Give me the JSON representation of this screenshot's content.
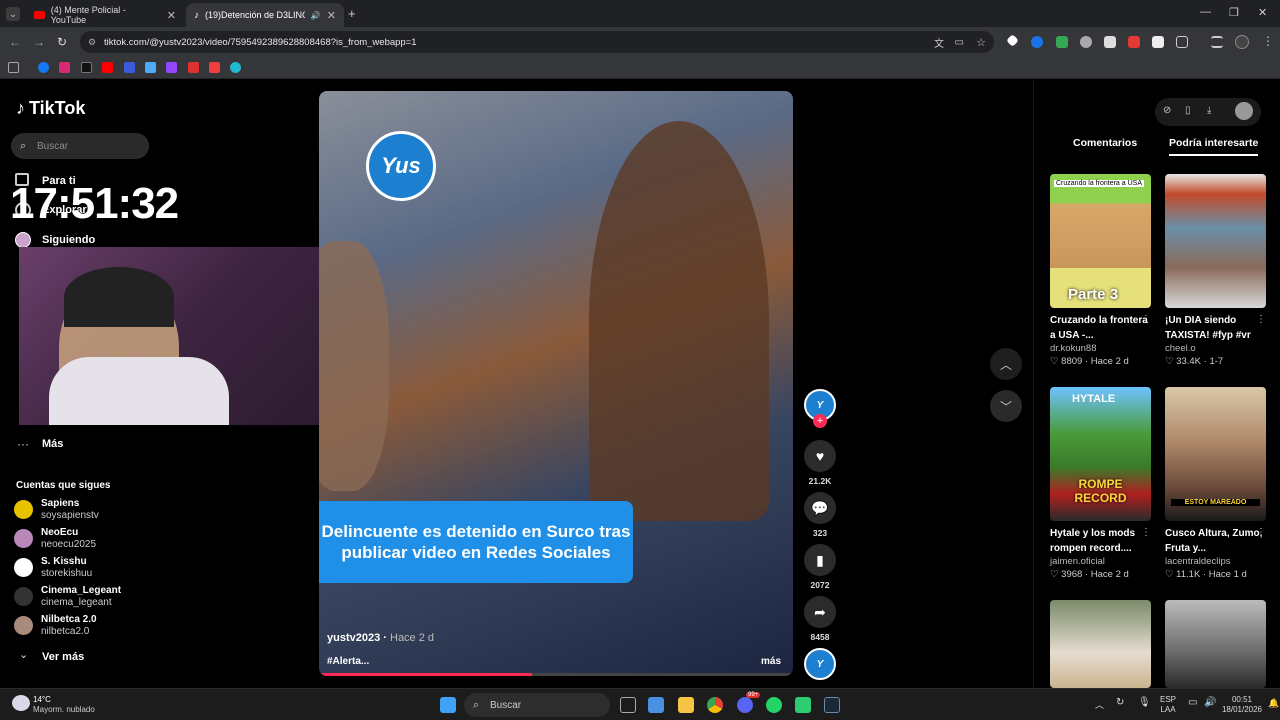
{
  "browser": {
    "tabs": [
      {
        "title": "(4) Mente Policial - YouTube",
        "icon": "youtube-icon"
      },
      {
        "title": "(19)Detención de D3LINCV",
        "icon": "tiktok-icon"
      }
    ],
    "url": "tiktok.com/@yustv2023/video/7595492389628808468?is_from_webapp=1"
  },
  "sidebar": {
    "logo": "TikTok",
    "search_placeholder": "Buscar",
    "nav": [
      "Para ti",
      "Explorar",
      "Siguiendo"
    ],
    "more": "Más",
    "following_title": "Cuentas que sigues",
    "following": [
      {
        "name": "Sapiens",
        "handle": "soysapienstv"
      },
      {
        "name": "NeoEcu",
        "handle": "neoecu2025"
      },
      {
        "name": "S. Kisshu",
        "handle": "storekishuu"
      },
      {
        "name": "Cinema_Legeant",
        "handle": "cinema_legeant"
      },
      {
        "name": "Nilbetca 2.0",
        "handle": "nilbetca2.0"
      }
    ],
    "see_more": "Ver más"
  },
  "overlay": {
    "clock": "17:51:32"
  },
  "video": {
    "logo_text": "Yus",
    "caption": "Delincuente es detenido en Surco tras publicar video en Redes Sociales",
    "author": "yustv2023",
    "time": "Hace 2 d",
    "tags": "#Alerta...",
    "more": "más",
    "progress": 0.45,
    "actions": {
      "likes": "21.2K",
      "comments": "323",
      "saves": "2072",
      "shares": "8458"
    }
  },
  "panel": {
    "tabs": [
      "Comentarios",
      "Podría interesarte"
    ],
    "cards": [
      {
        "title": "Cruzando la frontera a USA -...",
        "author": "dr.kokun88",
        "likes": "8809",
        "time": "Hace 2 d",
        "overlay_top": "Cruzando la frontera a USA",
        "overlay_bottom": "Parte 3"
      },
      {
        "title": "¡Un DIA siendo TAXISTA! #fyp #vr",
        "author": "cheel.o",
        "likes": "33.4K",
        "time": "1-7"
      },
      {
        "title": "Hytale y los mods rompen record....",
        "author": "jaimen.oficial",
        "likes": "3968",
        "time": "Hace 2 d",
        "overlay_top": "HYTALE",
        "overlay_bottom": "ROMPE RECORD"
      },
      {
        "title": "Cusco Altura, Zumo, Fruta y...",
        "author": "lacentraldeclips",
        "likes": "11.1K",
        "time": "Hace 1 d",
        "overlay_bottom": "ESTOY MAREADO"
      },
      {
        "title": "",
        "author": "",
        "likes": "",
        "time": ""
      },
      {
        "title": "",
        "author": "",
        "likes": "",
        "time": ""
      }
    ]
  },
  "taskbar": {
    "weather_temp": "14°C",
    "weather_desc": "Mayorm. nublado",
    "search": "Buscar",
    "lang1": "ESP",
    "lang2": "LAA",
    "time": "00:51",
    "date": "18/01/2026",
    "notif_badge": "99+"
  }
}
